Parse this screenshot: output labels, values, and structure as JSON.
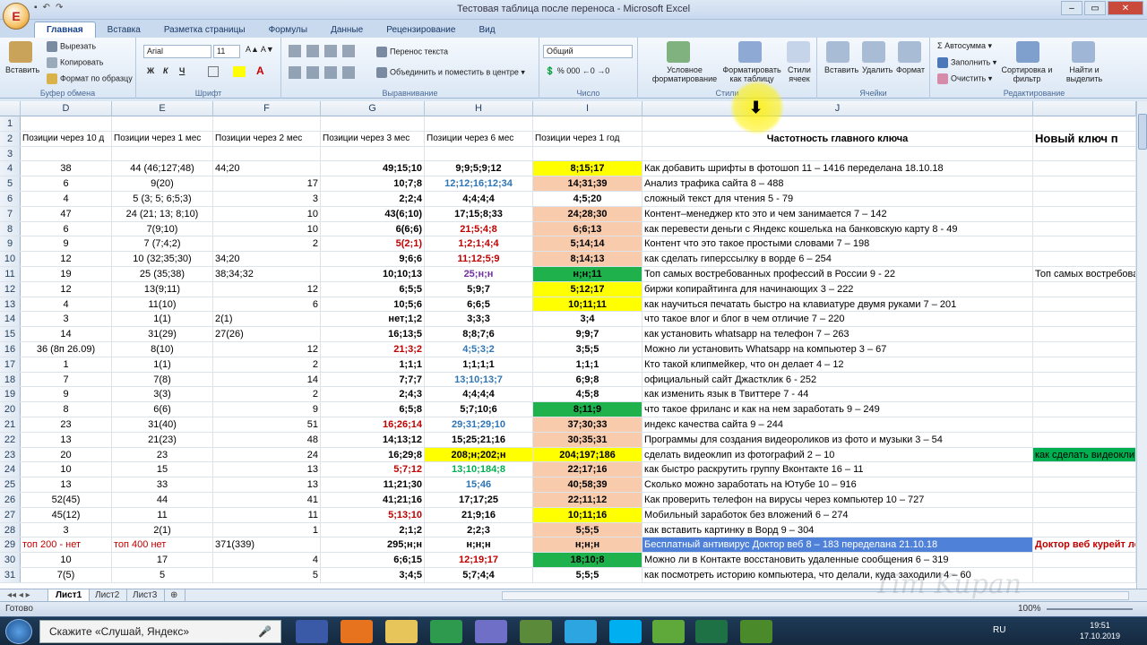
{
  "window": {
    "title": "Тестовая таблица после переноса - Microsoft Excel",
    "controls": [
      "–",
      "▭",
      "✕"
    ]
  },
  "office_button": {
    "label": "E"
  },
  "ribbon": {
    "tabs": [
      "Главная",
      "Вставка",
      "Разметка страницы",
      "Формулы",
      "Данные",
      "Рецензирование",
      "Вид"
    ],
    "clipboard": {
      "group": "Буфер обмена",
      "paste": "Вставить",
      "cut": "Вырезать",
      "copy": "Копировать",
      "format_painter": "Формат по образцу"
    },
    "font": {
      "group": "Шрифт",
      "name": "Arial",
      "size": "11",
      "bold": "Ж",
      "italic": "К",
      "underline": "Ч"
    },
    "alignment": {
      "group": "Выравнивание",
      "wrap": "Перенос текста",
      "merge": "Объединить и поместить в центре"
    },
    "number": {
      "group": "Число",
      "format": "Общий"
    },
    "styles": {
      "group": "Стили",
      "conditional": "Условное форматирование",
      "as_table": "Форматировать как таблицу",
      "cell_styles": "Стили ячеек"
    },
    "cells": {
      "group": "Ячейки",
      "insert": "Вставить",
      "delete": "Удалить",
      "format": "Формат"
    },
    "editing": {
      "group": "Редактирование",
      "autosum": "Автосумма",
      "fill": "Заполнить",
      "clear": "Очистить",
      "sort": "Сортировка и фильтр",
      "find": "Найти и выделить"
    }
  },
  "columns": [
    "D",
    "E",
    "F",
    "G",
    "H",
    "I",
    "J"
  ],
  "rows": [
    {
      "n": "1",
      "cells": []
    },
    {
      "n": "2",
      "cells": [
        "Позиции через 10 д",
        "Позиции через 1 мес",
        "Позиции через 2 мес",
        "Позиции через 3 мес",
        "Позиции через 6 мес",
        "Позиции через 1 год",
        "Частотность главного ключа",
        "Новый ключ п"
      ]
    },
    {
      "n": "3",
      "cells": []
    },
    {
      "n": "4",
      "cells": [
        "38",
        "44 (46;127;48)",
        "44;20",
        "",
        "49;15;10",
        "9;9;5;9;12",
        "8;15;17",
        "Как добавить шрифты в фотошоп    11 – 1416          переделана 18.10.18",
        ""
      ]
    },
    {
      "n": "5",
      "cells": [
        "6",
        "9(20)",
        "",
        "17",
        "10;7;8",
        "12;12;16;12;34",
        "14;31;39",
        "Анализ трафика сайта    8 – 488",
        ""
      ]
    },
    {
      "n": "6",
      "cells": [
        "4",
        "5 (3; 5; 6;5;3)",
        "",
        "3",
        "2;2;4",
        "4;4;4;4",
        "4;5;20",
        "сложный текст для чтения   5 - 79",
        ""
      ]
    },
    {
      "n": "7",
      "cells": [
        "47",
        "24 (21; 13; 8;10)",
        "",
        "10",
        "43(6;10)",
        "17;15;8;33",
        "24;28;30",
        "Контент–менеджер кто это и чем занимается   7 – 142",
        ""
      ]
    },
    {
      "n": "8",
      "cells": [
        "6",
        "7(9;10)",
        "",
        "10",
        "6(6;6)",
        "21;5;4;8",
        "6;6;13",
        "как перевести деньги с Яндекс кошелька на банковскую карту   8 - 49",
        ""
      ]
    },
    {
      "n": "9",
      "cells": [
        "9",
        "7 (7;4;2)",
        "",
        "2",
        "5(2;1)",
        "1;2;1;4;4",
        "5;14;14",
        "Контент что это такое простыми словами       7 – 198",
        ""
      ]
    },
    {
      "n": "10",
      "cells": [
        "12",
        "10 (32;35;30)",
        "34;20",
        "",
        "9;6;6",
        "11;12;5;9",
        "8;14;13",
        "как сделать гиперссылку в ворде       6 – 254",
        ""
      ]
    },
    {
      "n": "11",
      "cells": [
        "19",
        "25 (35;38)",
        "38;34;32",
        "",
        "10;10;13",
        "25;н;н",
        "н;н;11",
        " Топ самых востребованных профессий в России   9 - 22",
        "Топ самых востребова"
      ]
    },
    {
      "n": "12",
      "cells": [
        "12",
        "13(9;11)",
        "",
        "12",
        "6;5;5",
        "5;9;7",
        "5;12;17",
        " биржи копирайтинга для начинающих       3 – 222",
        ""
      ]
    },
    {
      "n": "13",
      "cells": [
        "4",
        "11(10)",
        "",
        "6",
        "10;5;6",
        "6;6;5",
        "10;11;11",
        "как научиться печатать быстро на клавиатуре двумя руками     7 – 201",
        ""
      ]
    },
    {
      "n": "14",
      "cells": [
        "3",
        "1(1)",
        "2(1)",
        "",
        "нет;1;2",
        "3;3;3",
        "3;4",
        "что такое влог и блог в чем отличие        7 – 220",
        ""
      ]
    },
    {
      "n": "15",
      "cells": [
        "14",
        "31(29)",
        "27(26)",
        "",
        "16;13;5",
        "8;8;7;6",
        "9;9;7",
        "как установить whatsapp на телефон        7 – 263",
        ""
      ]
    },
    {
      "n": "16",
      "cells": [
        "36 (8п 26.09)",
        "8(10)",
        "",
        "12",
        "21;3;2",
        "4;5;3;2",
        "3;5;5",
        "Можно ли установить Whatsapp на компьютер    3 – 67",
        ""
      ]
    },
    {
      "n": "17",
      "cells": [
        "1",
        "1(1)",
        "",
        "2",
        "1;1;1",
        "1;1;1;1",
        "1;1;1",
        "Кто такой клипмейкер, что он делает       4 – 12",
        ""
      ]
    },
    {
      "n": "18",
      "cells": [
        "7",
        "7(8)",
        "",
        "14",
        "7;7;7",
        "13;10;13;7",
        "6;9;8",
        "официальный сайт Джастклик   6 - 252",
        ""
      ]
    },
    {
      "n": "19",
      "cells": [
        "9",
        "3(3)",
        "",
        "2",
        "2;4;3",
        "4;4;4;4",
        "4;5;8",
        "как изменить язык в Твиттере          7 - 44",
        ""
      ]
    },
    {
      "n": "20",
      "cells": [
        "8",
        "6(6)",
        "",
        "9",
        "6;5;8",
        "5;7;10;6",
        "8;11;9",
        "что такое фриланс и как на нем заработать        9 – 249",
        ""
      ]
    },
    {
      "n": "21",
      "cells": [
        "23",
        "31(40)",
        "",
        "51",
        "16;26;14",
        "29;31;29;10",
        "37;30;33",
        "индекс качества сайта       9 – 244",
        ""
      ]
    },
    {
      "n": "22",
      "cells": [
        "13",
        "21(23)",
        "",
        "48",
        "14;13;12",
        "15;25;21;16",
        "30;35;31",
        "Программы для создания видеороликов из фото и музыки       3 – 54",
        ""
      ]
    },
    {
      "n": "23",
      "cells": [
        "20",
        "23",
        "",
        "24",
        "16;29;8",
        "208;н;202;н",
        "204;197;186",
        "сделать видеоклип из фотографий          2 – 10",
        "как сделать видеокли"
      ]
    },
    {
      "n": "24",
      "cells": [
        "10",
        "15",
        "",
        "13",
        "5;7;12",
        "13;10;184;8",
        "22;17;16",
        "как быстро раскрутить группу Вконтакте        16 – 11",
        ""
      ]
    },
    {
      "n": "25",
      "cells": [
        "13",
        "33",
        "",
        "13",
        "11;21;30",
        "15;46",
        "40;58;39",
        "Сколько можно заработать на Ютубе       10 – 916",
        ""
      ]
    },
    {
      "n": "26",
      "cells": [
        "52(45)",
        "44",
        "",
        "41",
        "41;21;16",
        "17;17;25",
        "22;11;12",
        "Как проверить телефон на вирусы через компьютер          10 – 727",
        ""
      ]
    },
    {
      "n": "27",
      "cells": [
        "45(12)",
        "11",
        "",
        "11",
        "5;13;10",
        "21;9;16",
        "10;11;16",
        "Мобильный заработок без вложений         6 – 274",
        ""
      ]
    },
    {
      "n": "28",
      "cells": [
        "3",
        "2(1)",
        "",
        "1",
        "2;1;2",
        "2;2;3",
        "5;5;5",
        "как вставить картинку в Ворд          9 – 304",
        ""
      ]
    },
    {
      "n": "29",
      "cells": [
        "топ 200 - нет",
        "топ 400 нет",
        "371(339)",
        "",
        "295;н;н",
        "н;н;н",
        "н;н;н",
        "Бесплатный антивирус Доктор веб      8 – 183      переделана 21.10.18",
        "Доктор веб курейт ле"
      ]
    },
    {
      "n": "30",
      "cells": [
        "10",
        "17",
        "",
        "4",
        "6;6;15",
        "12;19;17",
        "18;10;8",
        "Можно ли в Контакте восстановить удаленные сообщения   6 – 319",
        ""
      ]
    },
    {
      "n": "31",
      "cells": [
        "7(5)",
        "5",
        "",
        "5",
        "3;4;5",
        "5;7;4;4",
        "5;5;5",
        "как посмотреть историю компьютера, что делали, куда заходили    4 – 60",
        ""
      ]
    }
  ],
  "sheets": [
    "Лист1",
    "Лист2",
    "Лист3"
  ],
  "status": {
    "ready": "Готово",
    "zoom": "100%"
  },
  "taskbar": {
    "search_placeholder": "Скажите «Слушай, Яндекс»",
    "time": "19:51",
    "date": "17.10.2019",
    "lang": "RU"
  },
  "watermark": "Tim Kupan",
  "colors": {
    "yellow": "#ffff00",
    "green": "#1fb14b",
    "salmon": "#f8cbad",
    "blue": "#4f81d8",
    "lightgreen": "#00b050"
  }
}
